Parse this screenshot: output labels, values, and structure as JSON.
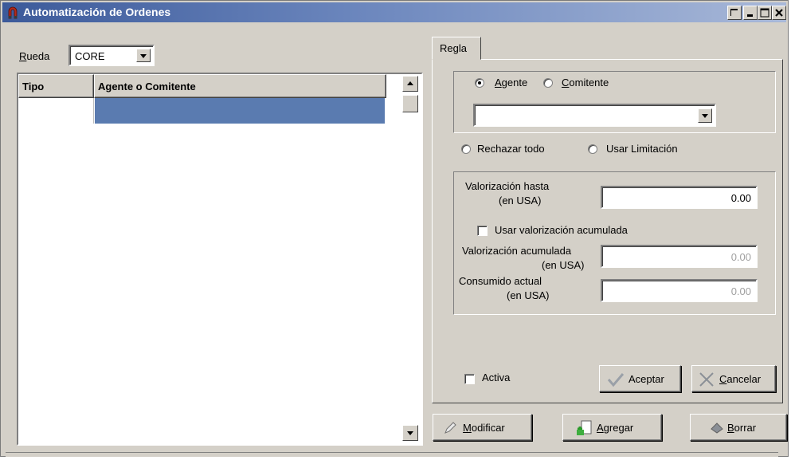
{
  "window": {
    "title": "Automatización de Ordenes",
    "icon": "horseshoe-magnet-icon"
  },
  "left": {
    "rueda_label_first": "R",
    "rueda_label_rest": "ueda",
    "rueda_value": "CORE",
    "columns": [
      "Tipo",
      "Agente o Comitente"
    ],
    "rows": [
      {
        "tipo": "",
        "agente": ""
      }
    ]
  },
  "tab": {
    "label": "Regla"
  },
  "selector": {
    "agente_first": "A",
    "agente_rest": "gente",
    "comitente_first": "C",
    "comitente_rest": "omitente",
    "selected": "Agente",
    "combo_value": ""
  },
  "mode": {
    "rechazar": "Rechazar todo",
    "usar": "Usar Limitación"
  },
  "valorizacion": {
    "hasta_line1": "Valorización hasta",
    "hasta_line2": "(en USA)",
    "hasta_value": "0.00",
    "usar_acumulada": "Usar valorización acumulada",
    "acum_line1": "Valorización acumulada",
    "acum_line2": "(en USA)",
    "acum_value": "0.00",
    "consumido_line1": "Consumido actual",
    "consumido_line2": "(en USA)",
    "consumido_value": "0.00"
  },
  "activa": "Activa",
  "buttons": {
    "aceptar": "Aceptar",
    "cancelar_first": "C",
    "cancelar_rest": "ancelar",
    "modificar_first": "M",
    "modificar_rest": "odificar",
    "agregar_first": "A",
    "agregar_rest": "gregar",
    "borrar_first": "B",
    "borrar_rest": "orrar"
  },
  "colors": {
    "titlebar": "#3c5a9a",
    "selection": "#5a7bb0",
    "face": "#d4d0c8"
  }
}
